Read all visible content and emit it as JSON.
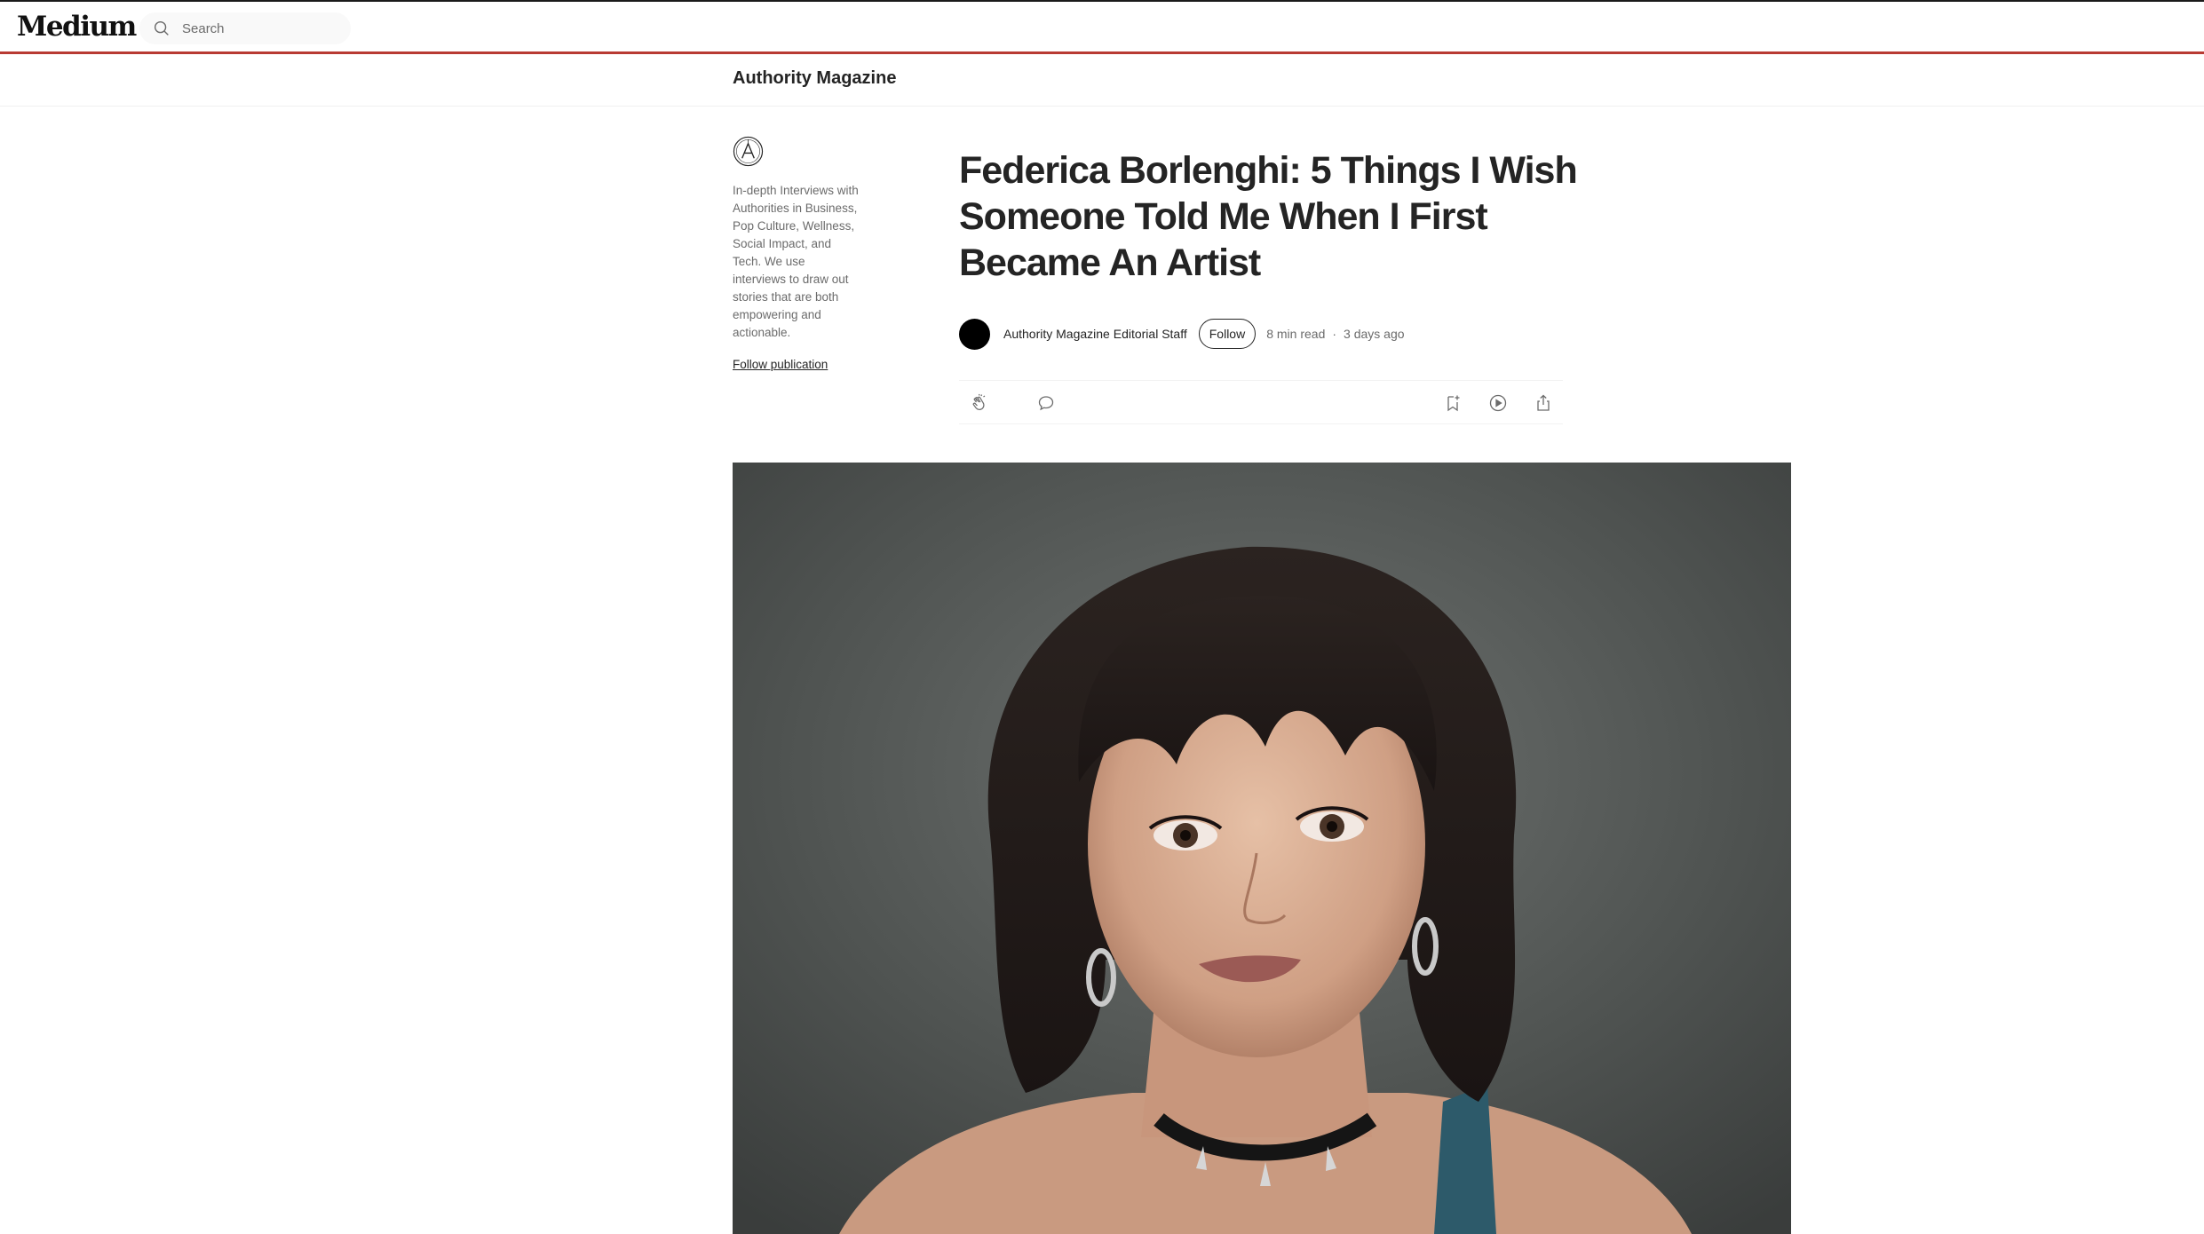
{
  "brand": {
    "logo_text": "Medium"
  },
  "search": {
    "placeholder": "Search"
  },
  "publication": {
    "name": "Authority Magazine",
    "logo_icon": "authority-magazine-logo",
    "description": "In-depth Interviews with Authorities in Business, Pop Culture, Wellness, Social Impact, and Tech. We use interviews to draw out stories that are both empowering and actionable.",
    "follow_label": "Follow publication"
  },
  "article": {
    "title": "Federica Borlenghi: 5 Things I Wish Someone Told Me When I First Became An Artist",
    "author": "Authority Magazine Editorial Staff",
    "follow_label": "Follow",
    "read_time": "8 min read",
    "separator": "·",
    "published": "3 days ago"
  },
  "actions": {
    "clap_icon": "clap-icon",
    "comment_icon": "comment-icon",
    "bookmark_icon": "bookmark-add-icon",
    "listen_icon": "play-icon",
    "share_icon": "share-icon"
  },
  "colors": {
    "topbar_accent": "#b83a33",
    "text_primary": "#242424",
    "text_secondary": "#6b6b6b"
  }
}
